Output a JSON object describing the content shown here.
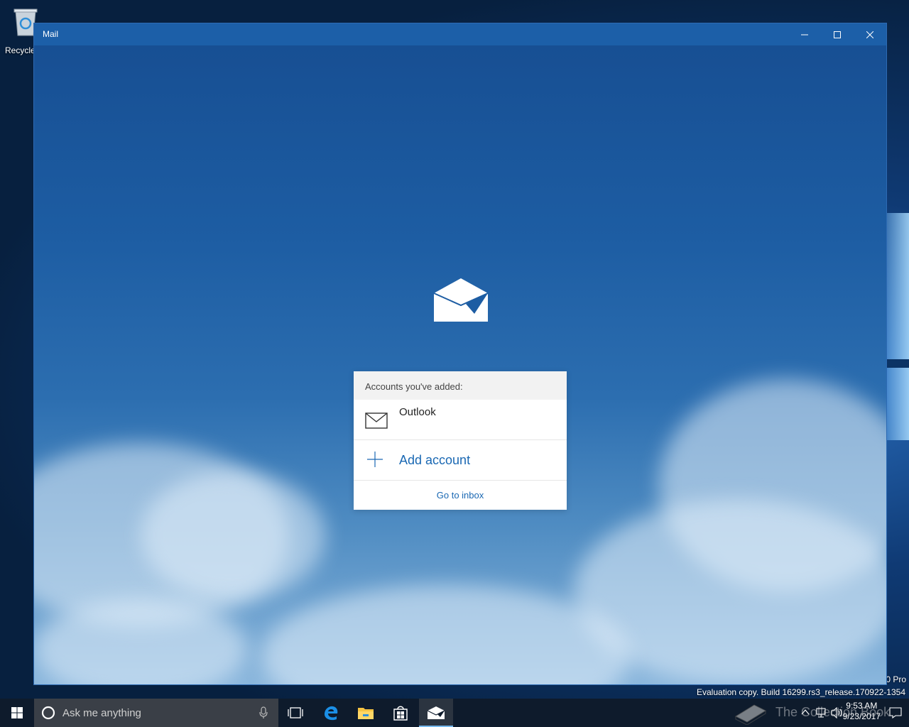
{
  "desktop": {
    "recycle_bin_label": "Recycle",
    "edition_fragment": "0 Pro",
    "evaluation_text": "Evaluation copy. Build 16299.rs3_release.170922-1354"
  },
  "window": {
    "title": "Mail",
    "controls": {
      "minimize": "minimize-icon",
      "maximize": "maximize-icon",
      "close": "close-icon"
    }
  },
  "accounts_card": {
    "header": "Accounts you've added:",
    "accounts": [
      {
        "name": "Outlook",
        "icon": "envelope-icon"
      }
    ],
    "add_account_label": "Add account",
    "go_to_inbox_label": "Go to inbox"
  },
  "taskbar": {
    "search_placeholder": "Ask me anything",
    "apps": [
      "task-view-icon",
      "edge-icon",
      "file-explorer-icon",
      "store-icon",
      "mail-icon"
    ],
    "clock": {
      "time": "9:53 AM",
      "date": "9/23/2017"
    },
    "watermark": "The Collection Book"
  },
  "colors": {
    "accent": "#1a68b3",
    "titlebar": "#1c5fa8",
    "taskbar": "#0e1b2c"
  }
}
